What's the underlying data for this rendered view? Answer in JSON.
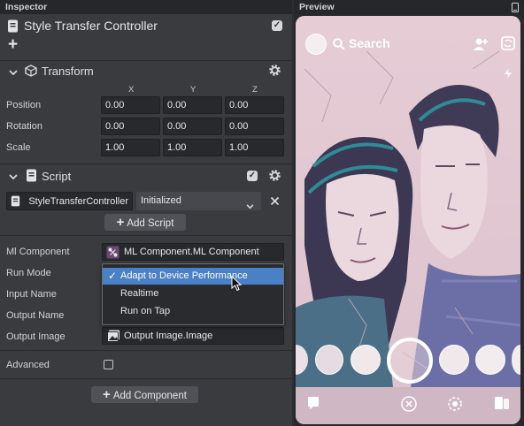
{
  "inspector": {
    "title": "Inspector",
    "object_name": "Style Transfer Controller",
    "add_icon": "+",
    "transform": {
      "title": "Transform",
      "columns": [
        "X",
        "Y",
        "Z"
      ],
      "rows": [
        {
          "label": "Position",
          "values": [
            "0.00",
            "0.00",
            "0.00"
          ]
        },
        {
          "label": "Rotation",
          "values": [
            "0.00",
            "0.00",
            "0.00"
          ]
        },
        {
          "label": "Scale",
          "values": [
            "1.00",
            "1.00",
            "1.00"
          ]
        }
      ]
    },
    "script": {
      "title": "Script",
      "script_name": "StyleTransferController",
      "state": "Initialized",
      "add_script": "Add Script"
    },
    "props": {
      "ml_component_label": "Ml Component",
      "ml_component_value": "ML Component.ML Component",
      "run_mode_label": "Run Mode",
      "input_name_label": "Input Name",
      "output_name_label": "Output Name",
      "output_image_label": "Output Image",
      "output_image_value": "Output Image.Image",
      "advanced_label": "Advanced"
    },
    "run_mode_menu": {
      "options": [
        "Adapt to Device Performance",
        "Realtime",
        "Run on Tap"
      ],
      "selected": "Adapt to Device Performance",
      "check": "✓"
    },
    "add_component": "Add Component"
  },
  "preview": {
    "title": "Preview",
    "search_label": "Search"
  },
  "colors": {
    "selection": "#4a80c6",
    "panel": "#3a3b3e",
    "field": "#28292c"
  }
}
